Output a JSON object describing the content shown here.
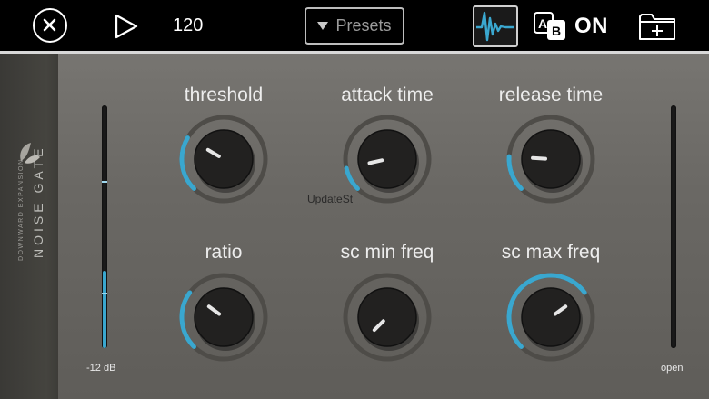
{
  "toolbar": {
    "tempo": "120",
    "presets_label": "Presets",
    "bypass_label": "ON"
  },
  "plugin": {
    "name": "NOISE GATE",
    "subtitle": "DOWNWARD EXPANSION",
    "overlay": "UpdateSt",
    "input_meter_label": "-12 dB",
    "output_meter_label": "open"
  },
  "knobs": [
    {
      "label": "threshold",
      "value": 0.28
    },
    {
      "label": "attack time",
      "value": 0.12
    },
    {
      "label": "release time",
      "value": 0.18
    },
    {
      "label": "ratio",
      "value": 0.3
    },
    {
      "label": "sc min freq",
      "value": 0.0
    },
    {
      "label": "sc max freq",
      "value": 0.7
    }
  ],
  "meters": {
    "input_level": 0.32,
    "input_marks": [
      0.68,
      0.22
    ],
    "output_level": 0.0
  },
  "colors": {
    "accent": "#3aa7cf",
    "panel": "#6a6864",
    "toolbar": "#000000"
  }
}
